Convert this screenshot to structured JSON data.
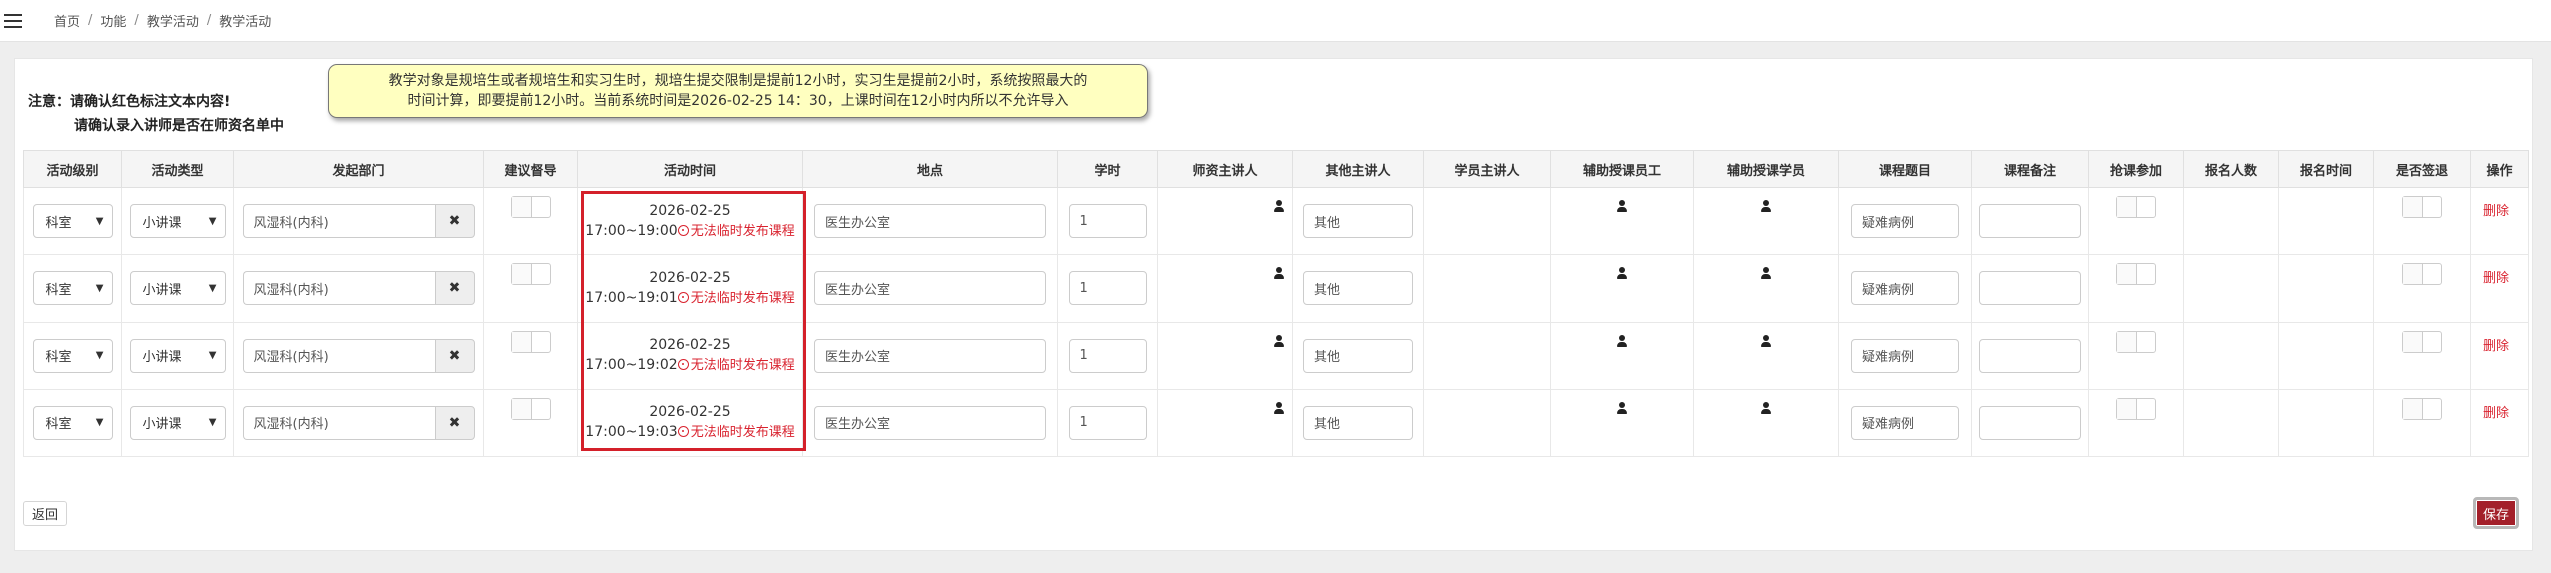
{
  "breadcrumb": [
    "首页",
    "功能",
    "教学活动",
    "教学活动"
  ],
  "notice": {
    "line1": "注意：请确认红色标注文本内容!",
    "line2": "请确认录入讲师是否在师资名单中"
  },
  "tooltip": {
    "line1": "教学对象是规培生或者规培生和实习生时，规培生提交限制是提前12小时，实习生是提前2小时，系统按照最大的",
    "line2": "时间计算，即要提前12小时。当前系统时间是2026-02-25 14：30，上课时间在12小时内所以不允许导入"
  },
  "columns": [
    "活动级别",
    "活动类型",
    "发起部门",
    "建议督导",
    "活动时间",
    "地点",
    "学时",
    "师资主讲人",
    "其他主讲人",
    "学员主讲人",
    "辅助授课员工",
    "辅助授课学员",
    "课程题目",
    "课程备注",
    "抢课参加",
    "报名人数",
    "报名时间",
    "是否签退",
    "操作"
  ],
  "rows": [
    {
      "level": "科室",
      "type": "小讲课",
      "dept": "风湿科(内科)",
      "date": "2026-02-25",
      "time": "17:00~19:00",
      "warning": "无法临时发布课程",
      "location": "医生办公室",
      "hours": "1",
      "other_speaker": "其他",
      "topic": "疑难病例",
      "action": "删除"
    },
    {
      "level": "科室",
      "type": "小讲课",
      "dept": "风湿科(内科)",
      "date": "2026-02-25",
      "time": "17:00~19:01",
      "warning": "无法临时发布课程",
      "location": "医生办公室",
      "hours": "1",
      "other_speaker": "其他",
      "topic": "疑难病例",
      "action": "删除"
    },
    {
      "level": "科室",
      "type": "小讲课",
      "dept": "风湿科(内科)",
      "date": "2026-02-25",
      "time": "17:00~19:02",
      "warning": "无法临时发布课程",
      "location": "医生办公室",
      "hours": "1",
      "other_speaker": "其他",
      "topic": "疑难病例",
      "action": "删除"
    },
    {
      "level": "科室",
      "type": "小讲课",
      "dept": "风湿科(内科)",
      "date": "2026-02-25",
      "time": "17:00~19:03",
      "warning": "无法临时发布课程",
      "location": "医生办公室",
      "hours": "1",
      "other_speaker": "其他",
      "topic": "疑难病例",
      "action": "删除"
    }
  ],
  "buttons": {
    "back": "返回",
    "save": "保存"
  },
  "colors": {
    "warning": "#d9232f",
    "save_bg": "#a3202a",
    "tooltip_bg": "#ffffc0"
  },
  "icons": [
    "menu-icon",
    "user-icon",
    "clear-icon",
    "warning-icon",
    "chevron-down-icon"
  ]
}
